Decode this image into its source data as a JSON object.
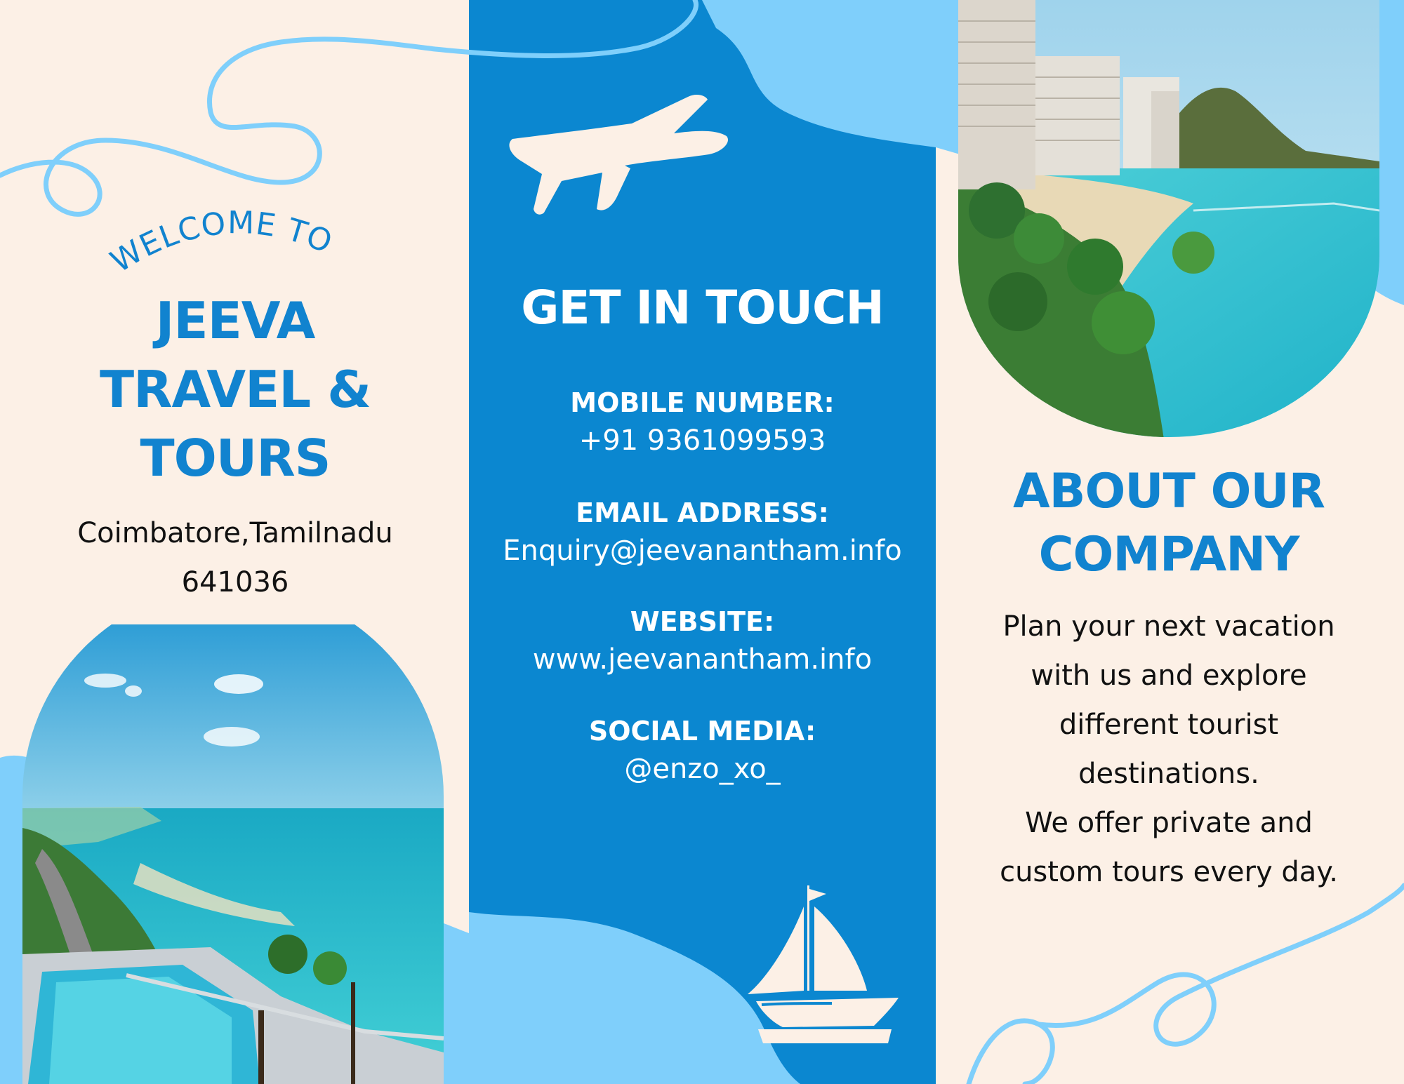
{
  "left_panel": {
    "welcome": "WELCOME TO",
    "name_lines": [
      "JEEVA",
      "TRAVEL &",
      "TOURS"
    ],
    "address_lines": [
      "Coimbatore,Tamilnadu",
      "641036"
    ]
  },
  "middle_panel": {
    "title": "GET IN TOUCH",
    "contacts": [
      {
        "label": "MOBILE NUMBER:",
        "value": "+91 9361099593"
      },
      {
        "label": "EMAIL ADDRESS:",
        "value": "Enquiry@jeevanantham.info"
      },
      {
        "label": "WEBSITE:",
        "value": "www.jeevanantham.info"
      },
      {
        "label": "SOCIAL MEDIA:",
        "value": "@enzo_xo_"
      }
    ]
  },
  "right_panel": {
    "title_lines": [
      "ABOUT OUR",
      "COMPANY"
    ],
    "body_lines": [
      "Plan your next vacation",
      "with us and explore",
      "different tourist",
      "destinations.",
      "We offer private and",
      "custom tours every day."
    ]
  },
  "icons": [
    "airplane-icon",
    "sailboat-icon"
  ],
  "colors": {
    "background": "#fcf0e6",
    "panel_blue": "#0b87d0",
    "light_blue": "#7fcffb",
    "accent_text": "#1183cf"
  }
}
